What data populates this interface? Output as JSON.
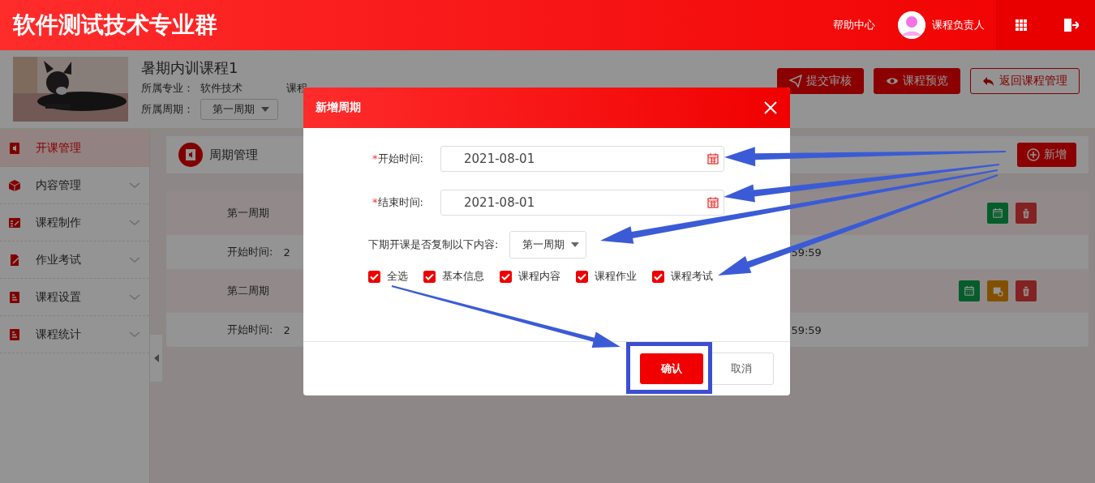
{
  "header": {
    "title": "软件测试技术专业群",
    "help": "帮助中心",
    "user": "课程负责人"
  },
  "course": {
    "name": "暑期内训课程1",
    "major_label": "所属专业：",
    "major": "软件技术",
    "partial": "课程",
    "period_label": "所属周期：",
    "period": "第一周期"
  },
  "actions": [
    {
      "label": "提交审核",
      "kind": "solid"
    },
    {
      "label": "课程预览",
      "kind": "solid"
    },
    {
      "label": "返回课程管理",
      "kind": "outline"
    }
  ],
  "sidebar": [
    {
      "label": "开课管理",
      "selected": true,
      "expandable": false
    },
    {
      "label": "内容管理",
      "selected": false,
      "expandable": true
    },
    {
      "label": "课程制作",
      "selected": false,
      "expandable": true
    },
    {
      "label": "作业考试",
      "selected": false,
      "expandable": true
    },
    {
      "label": "课程设置",
      "selected": false,
      "expandable": true
    },
    {
      "label": "课程统计",
      "selected": false,
      "expandable": true
    }
  ],
  "panel": {
    "title": "周期管理",
    "add": "新增"
  },
  "periods": [
    {
      "name": "第一周期",
      "time_label": "开始时间:",
      "time_start": "2",
      "time_end": "59:59",
      "tools": [
        {
          "kind": "calendar"
        },
        {
          "kind": "delete"
        }
      ]
    },
    {
      "name": "第二周期",
      "time_label": "开始时间:",
      "time_start": "2",
      "time_end": "59:59",
      "tools": [
        {
          "kind": "calendar"
        },
        {
          "kind": "schedule"
        },
        {
          "kind": "delete"
        }
      ]
    }
  ],
  "dialog": {
    "title": "新增周期",
    "fields": [
      {
        "label": "开始时间:",
        "required": true,
        "required_mark": "*",
        "value": "2021-08-01"
      },
      {
        "label": "结束时间:",
        "required": true,
        "required_mark": "*",
        "value": "2021-08-01"
      }
    ],
    "copy_label": "下期开课是否复制以下内容:",
    "copy_select": "第一周期",
    "options": [
      {
        "label": "全选",
        "checked": true
      },
      {
        "label": "基本信息",
        "checked": true
      },
      {
        "label": "课程内容",
        "checked": true
      },
      {
        "label": "课程作业",
        "checked": true
      },
      {
        "label": "课程考试",
        "checked": true
      }
    ],
    "confirm": "确认",
    "cancel": "取消"
  }
}
